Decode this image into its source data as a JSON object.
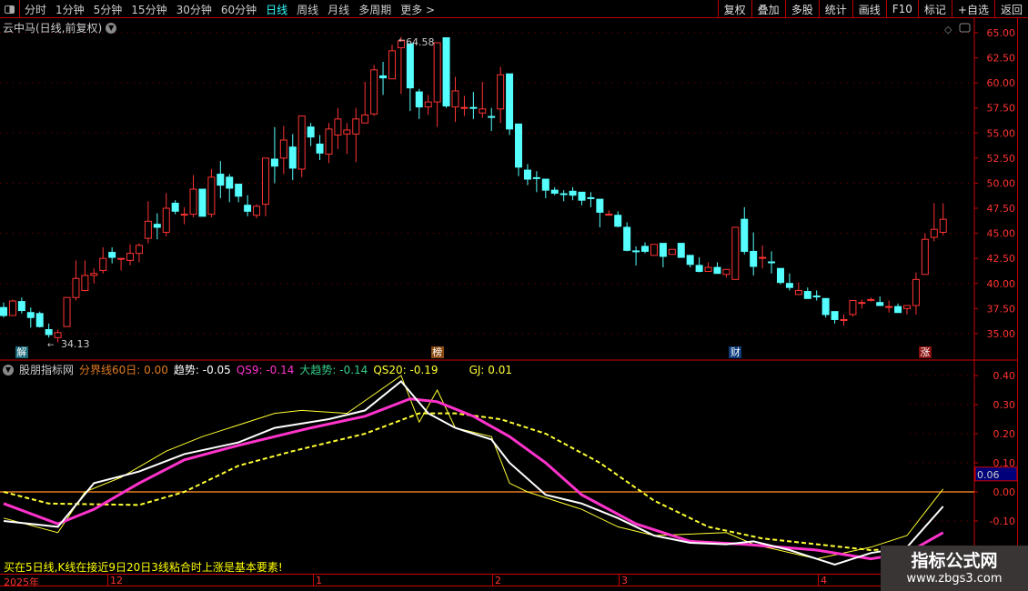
{
  "toolbar": {
    "periods": [
      "分时",
      "1分钟",
      "5分钟",
      "15分钟",
      "30分钟",
      "60分钟",
      "日线",
      "周线",
      "月线",
      "多周期",
      "更多 >"
    ],
    "active_period": "日线",
    "buttons": [
      "复权",
      "叠加",
      "多股",
      "统计",
      "画线",
      "F10",
      "标记",
      "+自选",
      "返回"
    ]
  },
  "title": "云中马(日线,前复权)",
  "price_axis": {
    "ticks": [
      "65.00",
      "62.50",
      "60.00",
      "57.50",
      "55.00",
      "52.50",
      "50.00",
      "47.50",
      "45.00",
      "42.50",
      "40.00",
      "37.50",
      "35.00"
    ],
    "min": 33.5,
    "max": 65.5
  },
  "high_label": "64.58",
  "low_label": "34.13",
  "markers": [
    {
      "text": "解",
      "bar": 2,
      "color": "#1a6a7a"
    },
    {
      "text": "榜",
      "bar": 48,
      "color": "#8a4a10"
    },
    {
      "text": "财",
      "bar": 81,
      "color": "#0a3a7a"
    },
    {
      "text": "涨",
      "bar": 102,
      "color": "#8a1010"
    }
  ],
  "candles": [
    [
      37.6,
      38.1,
      36.6,
      36.8
    ],
    [
      36.8,
      38.4,
      36.8,
      38.25
    ],
    [
      38.2,
      38.6,
      37.0,
      37.3
    ],
    [
      37.1,
      37.6,
      35.6,
      36.6
    ],
    [
      37.0,
      37.2,
      35.6,
      35.7
    ],
    [
      35.4,
      36.0,
      34.6,
      34.9
    ],
    [
      34.6,
      35.4,
      34.13,
      35.1
    ],
    [
      35.7,
      38.6,
      35.7,
      38.6
    ],
    [
      38.6,
      42.3,
      38.3,
      40.5
    ],
    [
      39.3,
      42.3,
      39.2,
      40.8
    ],
    [
      40.8,
      41.5,
      40.0,
      41.0
    ],
    [
      41.3,
      43.6,
      41.0,
      42.5
    ],
    [
      43.1,
      43.6,
      42.0,
      42.6
    ],
    [
      42.5,
      42.5,
      41.3,
      42.5
    ],
    [
      42.3,
      43.9,
      41.8,
      43.0
    ],
    [
      43.0,
      44.0,
      42.1,
      43.8
    ],
    [
      44.5,
      48.2,
      44.0,
      46.2
    ],
    [
      45.9,
      47.0,
      44.4,
      45.6
    ],
    [
      45.1,
      49.0,
      44.7,
      47.5
    ],
    [
      48.0,
      48.3,
      46.9,
      47.2
    ],
    [
      46.9,
      47.6,
      45.9,
      46.9
    ],
    [
      46.9,
      50.8,
      46.6,
      49.4
    ],
    [
      49.4,
      49.4,
      46.7,
      46.7
    ],
    [
      46.9,
      51.4,
      46.6,
      50.6
    ],
    [
      50.9,
      52.2,
      48.5,
      49.8
    ],
    [
      50.6,
      50.9,
      48.1,
      49.5
    ],
    [
      49.9,
      49.9,
      48.1,
      48.7
    ],
    [
      47.8,
      48.8,
      46.7,
      47.2
    ],
    [
      46.8,
      47.9,
      46.5,
      47.7
    ],
    [
      47.9,
      52.5,
      46.7,
      52.5
    ],
    [
      52.4,
      55.6,
      50.0,
      51.7
    ],
    [
      52.5,
      55.7,
      50.9,
      54.3
    ],
    [
      53.6,
      54.9,
      50.3,
      51.5
    ],
    [
      51.4,
      56.7,
      50.6,
      56.7
    ],
    [
      55.6,
      56.0,
      53.7,
      54.6
    ],
    [
      53.9,
      54.8,
      52.3,
      53.0
    ],
    [
      52.9,
      56.0,
      52.0,
      55.4
    ],
    [
      54.8,
      57.5,
      53.4,
      56.4
    ],
    [
      54.9,
      56.0,
      52.9,
      55.3
    ],
    [
      54.9,
      57.5,
      52.1,
      56.4
    ],
    [
      56.0,
      60.1,
      56.0,
      56.8
    ],
    [
      56.9,
      61.8,
      56.7,
      61.3
    ],
    [
      60.7,
      62.1,
      58.8,
      60.5
    ],
    [
      60.4,
      63.8,
      60.4,
      63.2
    ],
    [
      63.5,
      64.58,
      58.9,
      64.2
    ],
    [
      63.9,
      63.9,
      57.2,
      59.5
    ],
    [
      59.1,
      59.4,
      56.4,
      57.6
    ],
    [
      57.6,
      58.8,
      56.8,
      58.1
    ],
    [
      58.1,
      64.0,
      55.6,
      64.0
    ],
    [
      64.5,
      64.5,
      57.5,
      57.7
    ],
    [
      57.6,
      60.6,
      56.1,
      59.2
    ],
    [
      57.5,
      58.7,
      56.7,
      57.55
    ],
    [
      57.55,
      59.1,
      56.4,
      57.5
    ],
    [
      57.0,
      60.1,
      56.5,
      57.4
    ],
    [
      56.65,
      57.5,
      55.2,
      56.6
    ],
    [
      57.4,
      61.6,
      56.0,
      60.8
    ],
    [
      60.9,
      60.9,
      54.8,
      55.4
    ],
    [
      55.9,
      55.9,
      50.7,
      51.6
    ],
    [
      51.3,
      51.9,
      49.8,
      50.4
    ],
    [
      50.55,
      51.2,
      49.1,
      50.5
    ],
    [
      50.4,
      50.4,
      48.5,
      49.3
    ],
    [
      49.3,
      49.6,
      48.8,
      49.0
    ],
    [
      48.95,
      49.3,
      48.2,
      48.9
    ],
    [
      49.2,
      49.6,
      48.3,
      48.8
    ],
    [
      49.1,
      49.1,
      47.8,
      48.3
    ],
    [
      48.55,
      49.1,
      47.6,
      48.5
    ],
    [
      48.4,
      48.4,
      45.6,
      47.1
    ],
    [
      46.85,
      47.3,
      46.8,
      46.9
    ],
    [
      46.8,
      47.2,
      45.6,
      45.7
    ],
    [
      45.6,
      46.1,
      43.2,
      43.3
    ],
    [
      43.25,
      43.7,
      41.8,
      43.2
    ],
    [
      43.7,
      44.1,
      43.0,
      43.2
    ],
    [
      42.8,
      43.9,
      42.8,
      43.9
    ],
    [
      44.0,
      44.0,
      41.6,
      42.7
    ],
    [
      42.9,
      43.4,
      42.9,
      43.4
    ],
    [
      44.0,
      44.0,
      42.6,
      42.6
    ],
    [
      42.8,
      42.8,
      41.6,
      41.9
    ],
    [
      41.8,
      42.6,
      41.1,
      41.2
    ],
    [
      41.2,
      42.1,
      41.2,
      41.6
    ],
    [
      41.6,
      42.1,
      41.0,
      41.0
    ],
    [
      40.9,
      41.4,
      40.6,
      41.4
    ],
    [
      40.4,
      45.6,
      40.4,
      45.6
    ],
    [
      46.4,
      47.6,
      42.9,
      43.2
    ],
    [
      43.2,
      45.1,
      40.8,
      41.7
    ],
    [
      42.55,
      43.8,
      41.5,
      42.6
    ],
    [
      42.15,
      43.2,
      41.0,
      42.1
    ],
    [
      41.5,
      41.5,
      39.9,
      40.1
    ],
    [
      40.0,
      41.0,
      39.3,
      39.6
    ],
    [
      38.9,
      40.1,
      38.9,
      39.3
    ],
    [
      39.2,
      39.6,
      38.5,
      38.5
    ],
    [
      38.75,
      39.3,
      38.3,
      38.7
    ],
    [
      38.5,
      38.5,
      36.6,
      36.9
    ],
    [
      37.2,
      37.2,
      36.0,
      36.4
    ],
    [
      36.35,
      36.9,
      35.8,
      36.4
    ],
    [
      36.9,
      38.3,
      36.7,
      38.3
    ],
    [
      38.05,
      38.4,
      37.5,
      38.1
    ],
    [
      38.35,
      38.6,
      38.2,
      38.4
    ],
    [
      38.1,
      38.7,
      37.8,
      37.8
    ],
    [
      37.65,
      38.3,
      37.1,
      37.7
    ],
    [
      37.7,
      38.0,
      37.1,
      37.1
    ],
    [
      37.5,
      37.8,
      36.9,
      37.8
    ],
    [
      37.8,
      41.1,
      36.9,
      40.4
    ],
    [
      40.9,
      45.0,
      40.9,
      44.4
    ],
    [
      44.6,
      48.0,
      44.2,
      45.4
    ],
    [
      45.1,
      48.0,
      44.8,
      46.4
    ]
  ],
  "indicator": {
    "name": "股朋指标网",
    "legend": [
      {
        "label": "分界线60日: 0.00",
        "color": "#e07a20"
      },
      {
        "label": "趋势: -0.05",
        "color": "#ffffff"
      },
      {
        "label": "QS9: -0.14",
        "color": "#ff33cc"
      },
      {
        "label": "大趋势: -0.14",
        "color": "#33cc88"
      },
      {
        "label": "QS20: -0.19",
        "color": "#ffff33"
      },
      {
        "label": "GJ: 0.01",
        "color": "#ffff33"
      }
    ],
    "axis_ticks": [
      "0.40",
      "0.30",
      "0.20",
      "0.10",
      "0.00",
      "-0.10"
    ],
    "current_value": "0.06",
    "baseline": 0.0,
    "series": {
      "trend": [
        [
          0,
          -0.1
        ],
        [
          6,
          -0.12
        ],
        [
          10,
          0.03
        ],
        [
          15,
          0.07
        ],
        [
          20,
          0.13
        ],
        [
          26,
          0.17
        ],
        [
          30,
          0.22
        ],
        [
          36,
          0.25
        ],
        [
          40,
          0.28
        ],
        [
          44,
          0.38
        ],
        [
          47,
          0.27
        ],
        [
          50,
          0.22
        ],
        [
          54,
          0.18
        ],
        [
          56,
          0.1
        ],
        [
          60,
          -0.01
        ],
        [
          64,
          -0.04
        ],
        [
          68,
          -0.09
        ],
        [
          72,
          -0.15
        ],
        [
          76,
          -0.175
        ],
        [
          80,
          -0.18
        ],
        [
          83,
          -0.17
        ],
        [
          87,
          -0.2
        ],
        [
          92,
          -0.25
        ],
        [
          96,
          -0.21
        ],
        [
          100,
          -0.19
        ],
        [
          104,
          -0.05
        ]
      ],
      "qs9": [
        [
          0,
          -0.04
        ],
        [
          6,
          -0.11
        ],
        [
          10,
          -0.06
        ],
        [
          15,
          0.03
        ],
        [
          20,
          0.11
        ],
        [
          26,
          0.16
        ],
        [
          34,
          0.22
        ],
        [
          40,
          0.26
        ],
        [
          45,
          0.32
        ],
        [
          48,
          0.31
        ],
        [
          52,
          0.26
        ],
        [
          56,
          0.19
        ],
        [
          60,
          0.1
        ],
        [
          64,
          -0.01
        ],
        [
          70,
          -0.11
        ],
        [
          76,
          -0.17
        ],
        [
          82,
          -0.18
        ],
        [
          90,
          -0.2
        ],
        [
          96,
          -0.23
        ],
        [
          100,
          -0.21
        ],
        [
          104,
          -0.14
        ]
      ],
      "qs20": [
        [
          0,
          0.0
        ],
        [
          5,
          -0.04
        ],
        [
          15,
          -0.045
        ],
        [
          20,
          0.0
        ],
        [
          26,
          0.09
        ],
        [
          32,
          0.14
        ],
        [
          40,
          0.2
        ],
        [
          46,
          0.27
        ],
        [
          50,
          0.27
        ],
        [
          55,
          0.25
        ],
        [
          60,
          0.2
        ],
        [
          66,
          0.1
        ],
        [
          72,
          -0.03
        ],
        [
          78,
          -0.12
        ],
        [
          84,
          -0.16
        ],
        [
          90,
          -0.18
        ],
        [
          96,
          -0.2
        ],
        [
          104,
          -0.19
        ]
      ],
      "gj": [
        [
          0,
          -0.09
        ],
        [
          6,
          -0.14
        ],
        [
          9,
          0.0
        ],
        [
          13,
          0.05
        ],
        [
          18,
          0.14
        ],
        [
          22,
          0.19
        ],
        [
          30,
          0.27
        ],
        [
          33,
          0.28
        ],
        [
          38,
          0.27
        ],
        [
          44,
          0.4
        ],
        [
          46,
          0.24
        ],
        [
          48,
          0.35
        ],
        [
          50,
          0.22
        ],
        [
          54,
          0.19
        ],
        [
          56,
          0.03
        ],
        [
          58,
          0.0
        ],
        [
          64,
          -0.06
        ],
        [
          68,
          -0.12
        ],
        [
          72,
          -0.15
        ],
        [
          80,
          -0.14
        ],
        [
          83,
          -0.18
        ],
        [
          90,
          -0.23
        ],
        [
          96,
          -0.19
        ],
        [
          100,
          -0.15
        ],
        [
          104,
          0.01
        ]
      ]
    }
  },
  "bottom_note": "买在5日线,K线在接近9日20日3线粘合时上涨是基本要素!",
  "date_axis": [
    {
      "label": "2025年",
      "x": 2
    },
    {
      "label": "12",
      "x": 118
    },
    {
      "label": "1",
      "x": 344
    },
    {
      "label": "2",
      "x": 541
    },
    {
      "label": "3",
      "x": 680
    },
    {
      "label": "4",
      "x": 899
    }
  ],
  "watermark": {
    "line1": "指标公式网",
    "line2": "www.zbgs3.com"
  },
  "colors": {
    "up": "#ff3333",
    "down": "#55ffff",
    "axis": "#cc0000"
  }
}
